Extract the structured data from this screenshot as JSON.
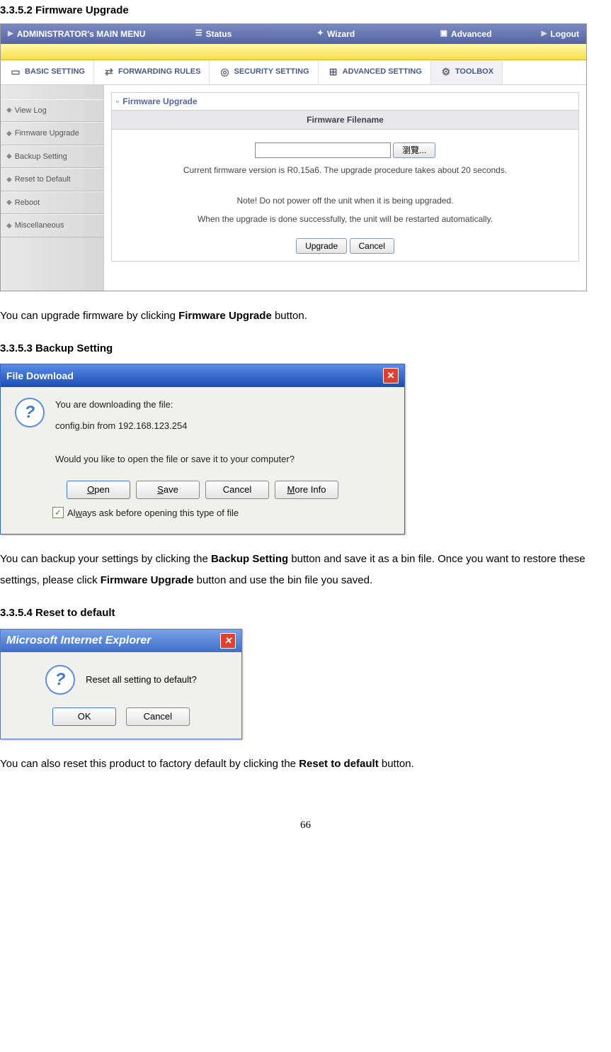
{
  "sections": {
    "s1": "3.3.5.2 Firmware Upgrade",
    "s2": "3.3.5.3 Backup Setting",
    "s3": "3.3.5.4 Reset to default"
  },
  "router": {
    "topmenu": {
      "admin": "ADMINISTRATOR's MAIN MENU",
      "status": "Status",
      "wizard": "Wizard",
      "advanced": "Advanced",
      "logout": "Logout"
    },
    "tabs": {
      "basic": "BASIC SETTING",
      "forwarding": "FORWARDING RULES",
      "security": "SECURITY SETTING",
      "advsetting": "ADVANCED SETTING",
      "toolbox": "TOOLBOX"
    },
    "sidebar": [
      "View Log",
      "Firmware Upgrade",
      "Backup Setting",
      "Reset to Default",
      "Reboot",
      "Miscellaneous"
    ],
    "panel": {
      "title": "Firmware Upgrade",
      "subtitle": "Firmware Filename",
      "browse": "瀏覽...",
      "line1": "Current firmware version is R0.15a6. The upgrade procedure takes about 20 seconds.",
      "line2": "Note! Do not power off the unit when it is being upgraded.",
      "line3": "When the upgrade is done successfully, the unit will be restarted automatically.",
      "upgrade": "Upgrade",
      "cancel": "Cancel"
    }
  },
  "desc1a": "You can upgrade firmware by clicking ",
  "desc1b": "Firmware Upgrade",
  "desc1c": " button.",
  "filedialog": {
    "title": "File Download",
    "line1": "You are downloading the file:",
    "line2": "config.bin from 192.168.123.254",
    "line3": "Would you like to open the file or save it to your computer?",
    "open": "Open",
    "save": "Save",
    "cancel": "Cancel",
    "more": "More Info",
    "always": "Always ask before opening this type of file"
  },
  "desc2a": "You can backup your settings by clicking the ",
  "desc2b": "Backup Setting",
  "desc2c": " button and save it as a bin file. Once you want to restore these settings, please click ",
  "desc2d": "Firmware Upgrade",
  "desc2e": " button and use the bin file you saved.",
  "resetdialog": {
    "title": "Microsoft Internet Explorer",
    "msg": "Reset all setting to default?",
    "ok": "OK",
    "cancel": "Cancel"
  },
  "desc3a": "You can also reset this product to factory default by clicking the ",
  "desc3b": "Reset to default",
  "desc3c": " button.",
  "pagenum": "66"
}
